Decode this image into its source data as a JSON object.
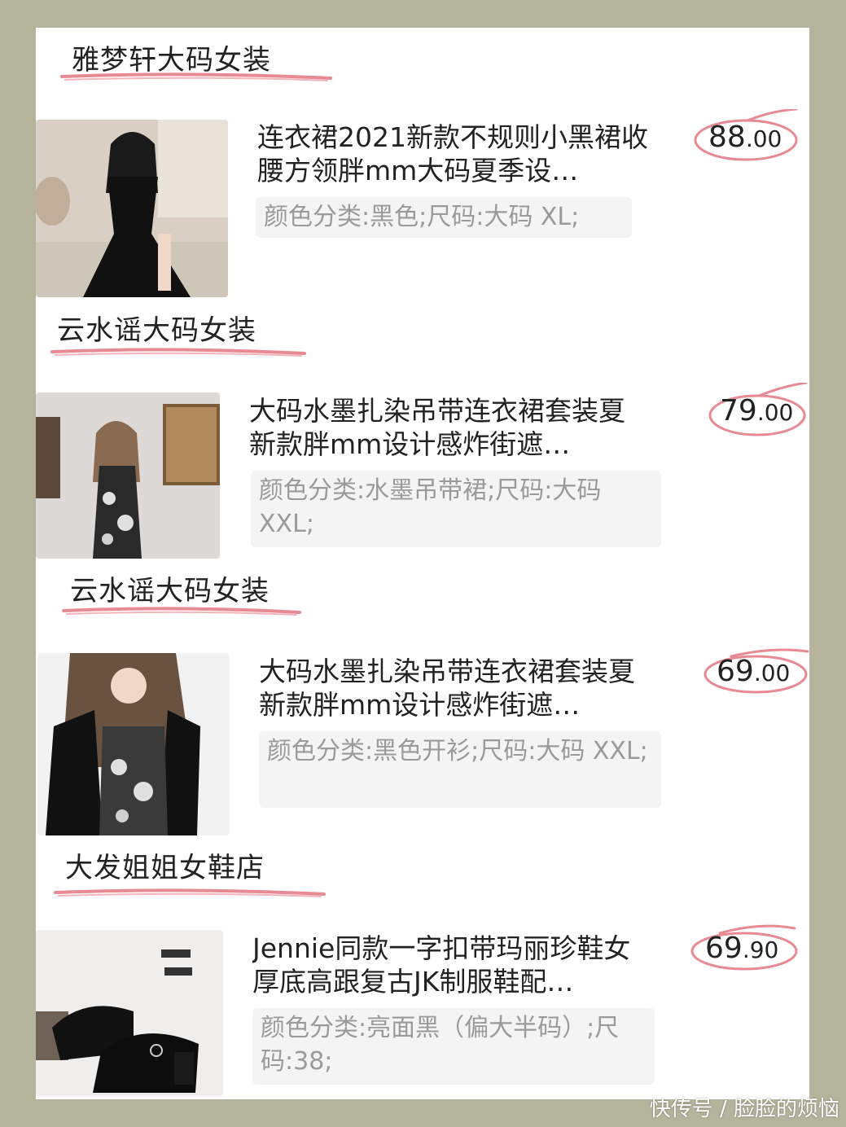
{
  "colors": {
    "background": "#b4b39c",
    "card": "#ffffff",
    "accent": "#e88a93"
  },
  "items": [
    {
      "shop": "雅梦轩大码女装",
      "title": "连衣裙2021新款不规则小黑裙收腰方领胖mm大码夏季设…",
      "sku": "颜色分类:黑色;尺码:大码 XL;",
      "price_int": "88",
      "price_dec": ".00"
    },
    {
      "shop": "云水谣大码女装",
      "title": "大码水墨扎染吊带连衣裙套装夏新款胖mm设计感炸街遮…",
      "sku": "颜色分类:水墨吊带裙;尺码:大码 XXL;",
      "price_int": "79",
      "price_dec": ".00"
    },
    {
      "shop": "云水谣大码女装",
      "title": "大码水墨扎染吊带连衣裙套装夏新款胖mm设计感炸街遮…",
      "sku": "颜色分类:黑色开衫;尺码:大码 XXL;",
      "price_int": "69",
      "price_dec": ".00"
    },
    {
      "shop": "大发姐姐女鞋店",
      "title": "Jennie同款一字扣带玛丽珍鞋女厚底高跟复古JK制服鞋配…",
      "sku": "颜色分类:亮面黑（偏大半码）;尺码:38;",
      "price_int": "69",
      "price_dec": ".90"
    }
  ],
  "watermark": "快传号 / 脸脸的烦恼"
}
